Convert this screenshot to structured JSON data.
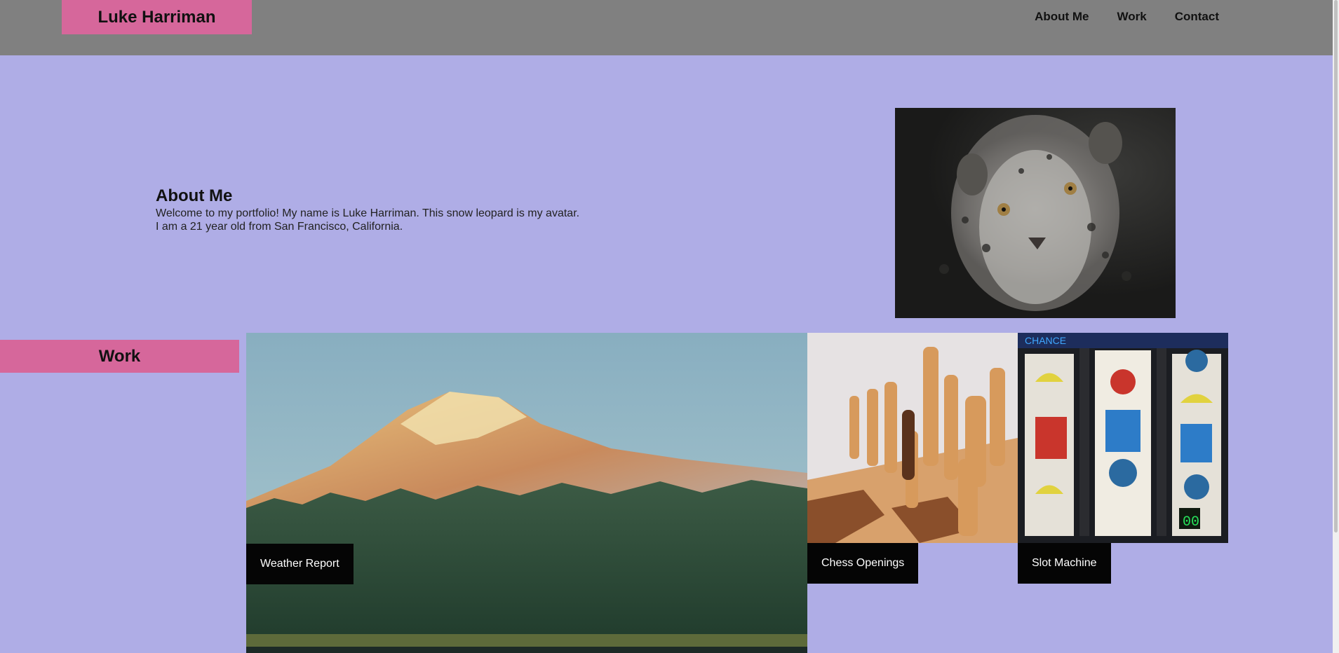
{
  "header": {
    "brand": "Luke Harriman",
    "nav": [
      "About Me",
      "Work",
      "Contact"
    ]
  },
  "about": {
    "title": "About Me",
    "line1": "Welcome to my portfolio! My name is Luke Harriman. This snow leopard is my avatar.",
    "line2": "I am a 21 year old from San Francisco, California."
  },
  "work": {
    "label": "Work",
    "projects": [
      {
        "title": "Weather Report"
      },
      {
        "title": "Chess Openings"
      },
      {
        "title": "Slot Machine"
      }
    ]
  },
  "colors": {
    "background": "#afade6",
    "header": "#808080",
    "accent": "#d6679b",
    "caption": "#050505"
  }
}
